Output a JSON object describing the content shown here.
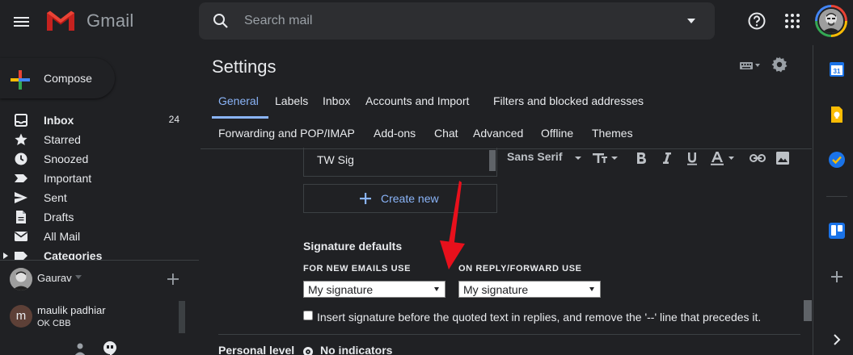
{
  "app": {
    "logo_text": "Gmail"
  },
  "search": {
    "placeholder": "Search mail"
  },
  "compose": {
    "label": "Compose"
  },
  "sidebar": {
    "items": [
      {
        "label": "Inbox",
        "count": "24",
        "icon": "inbox-icon",
        "bold": true
      },
      {
        "label": "Starred",
        "count": "",
        "icon": "star-icon"
      },
      {
        "label": "Snoozed",
        "count": "",
        "icon": "clock-icon"
      },
      {
        "label": "Important",
        "count": "",
        "icon": "important-icon"
      },
      {
        "label": "Sent",
        "count": "",
        "icon": "send-icon"
      },
      {
        "label": "Drafts",
        "count": "",
        "icon": "draft-icon"
      },
      {
        "label": "All Mail",
        "count": "",
        "icon": "mail-icon"
      },
      {
        "label": "Categories",
        "count": "",
        "icon": "label-icon",
        "bold": true
      }
    ]
  },
  "hangouts": {
    "user_name": "Gaurav",
    "contact": {
      "initial": "m",
      "name": "maulik padhiar",
      "status": "OK CBB"
    }
  },
  "settings": {
    "title": "Settings",
    "tabs_row1": [
      "General",
      "Labels",
      "Inbox",
      "Accounts and Import",
      "Filters and blocked addresses"
    ],
    "tabs_row2": [
      "Forwarding and POP/IMAP",
      "Add-ons",
      "Chat",
      "Advanced",
      "Offline",
      "Themes"
    ],
    "active_tab": "General"
  },
  "signature": {
    "list_item": "TW Sig",
    "font_name": "Sans Serif",
    "create_new_label": "Create new",
    "defaults_title": "Signature defaults",
    "new_emails_label": "FOR NEW EMAILS USE",
    "reply_label": "ON REPLY/FORWARD USE",
    "new_emails_value": "My signature",
    "reply_value": "My signature",
    "checkbox_label": "Insert signature before the quoted text in replies, and remove the '--' line that precedes it.",
    "checkbox_checked": false
  },
  "personal_level": {
    "label": "Personal level",
    "selected_option": "No indicators"
  },
  "colors": {
    "background": "#202124",
    "accent": "#8ab4f8",
    "annotation_arrow": "#e8101c"
  }
}
